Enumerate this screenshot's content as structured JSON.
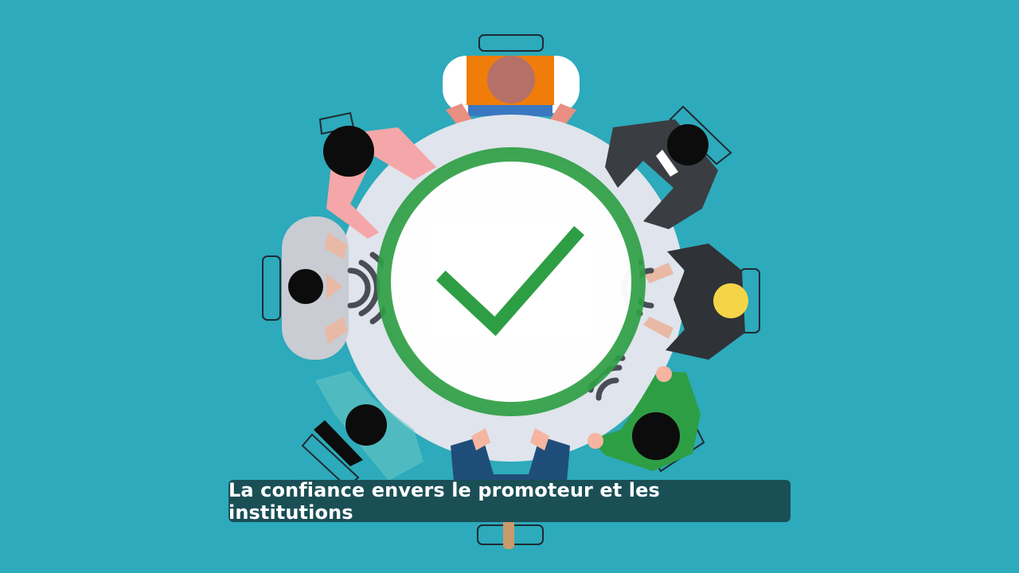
{
  "caption": {
    "text": "La confiance envers le promoteur et les institutions"
  },
  "colors": {
    "background": "#2daabb",
    "table": "#e0e4ec",
    "check_ring": "#2e9e44",
    "check_mark": "#2e9e44",
    "caption_bg": "#1a4f56",
    "caption_text": "#ffffff"
  },
  "icons": {
    "center": "checkmark-circle-icon",
    "left_sound": "sound-waves-icon",
    "right_sound": "sound-waves-icon",
    "bottom_sound": "sound-waves-icon"
  }
}
